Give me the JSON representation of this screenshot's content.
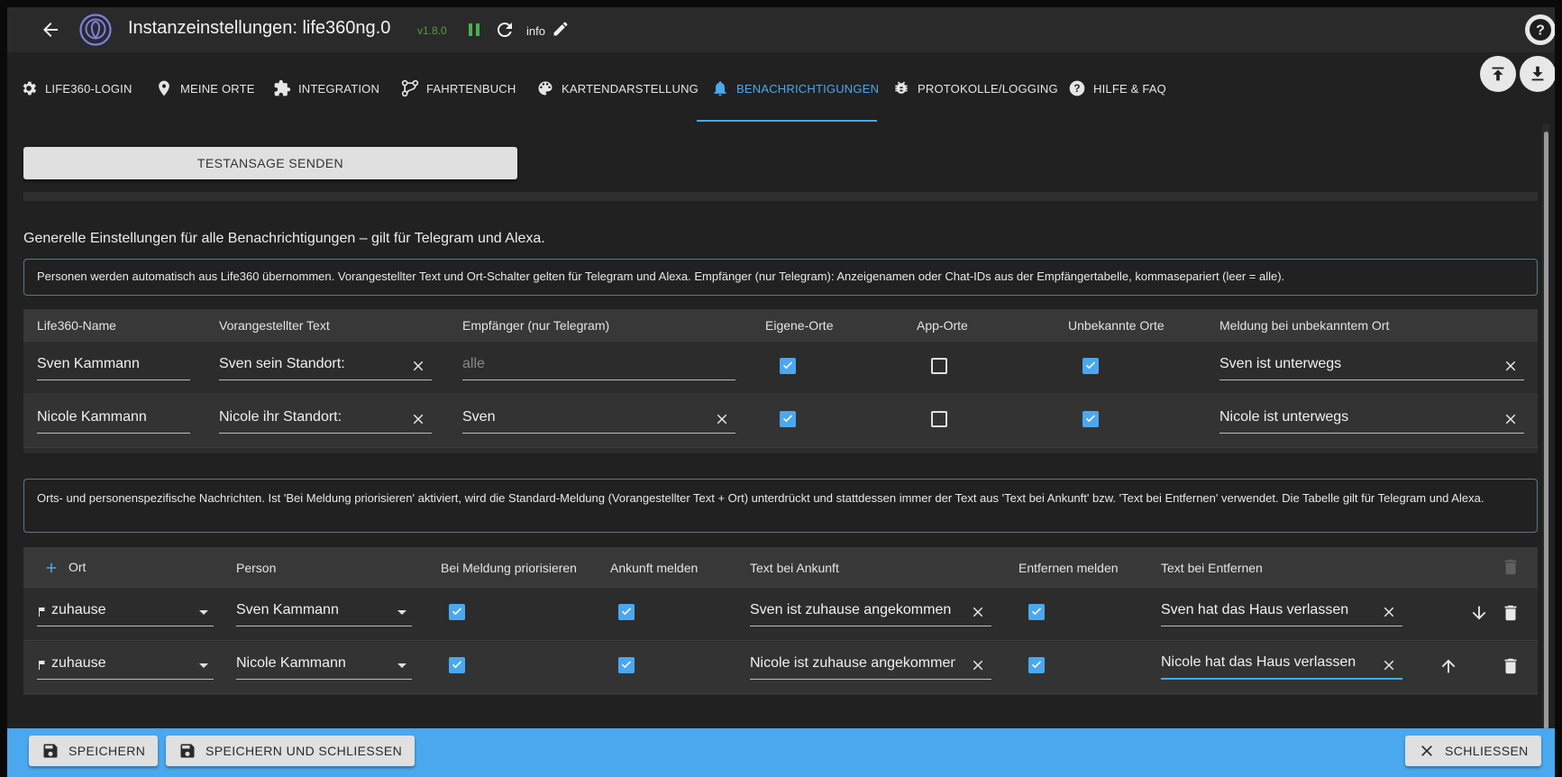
{
  "header": {
    "title": "Instanzeinstellungen:  life360ng.0",
    "version": "v1.8.0",
    "info_label": "info"
  },
  "tabs": [
    {
      "label": "LIFE360-LOGIN",
      "icon": "gear-icon"
    },
    {
      "label": "MEINE ORTE",
      "icon": "location-pin-icon"
    },
    {
      "label": "INTEGRATION",
      "icon": "puzzle-icon"
    },
    {
      "label": "FAHRTENBUCH",
      "icon": "route-icon"
    },
    {
      "label": "KARTENDARSTELLUNG",
      "icon": "palette-icon"
    },
    {
      "label": "BENACHRICHTIGUNGEN",
      "icon": "bell-icon",
      "active": true
    },
    {
      "label": "PROTOKOLLE/LOGGING",
      "icon": "bug-icon"
    },
    {
      "label": "HILFE & FAQ",
      "icon": "help-icon"
    }
  ],
  "test_button": "TESTANSAGE SENDEN",
  "general_heading": "Generelle Einstellungen für alle Benachrichtigungen – gilt für Telegram und Alexa.",
  "info1": "Personen werden automatisch aus Life360 übernommen. Vorangestellter Text und Ort-Schalter gelten für Telegram und Alexa. Empfänger (nur Telegram): Anzeigenamen oder Chat-IDs aus der Empfängertabelle, kommasepariert (leer = alle).",
  "persons_table": {
    "headers": [
      "Life360-Name",
      "Vorangestellter Text",
      "Empfänger (nur Telegram)",
      "Eigene-Orte",
      "App-Orte",
      "Unbekannte Orte",
      "Meldung bei unbekanntem Ort"
    ],
    "rows": [
      {
        "name": "Sven Kammann",
        "prefix": "Sven sein Standort:",
        "recipient": "",
        "recipient_placeholder": "alle",
        "own_places": true,
        "app_places": false,
        "unknown_places": true,
        "unknown_message": "Sven ist unterwegs"
      },
      {
        "name": "Nicole Kammann",
        "prefix": "Nicole ihr Standort:",
        "recipient": "Sven",
        "recipient_placeholder": "",
        "own_places": true,
        "app_places": false,
        "unknown_places": true,
        "unknown_message": "Nicole ist unterwegs"
      }
    ]
  },
  "info2": "Orts- und personenspezifische Nachrichten. Ist 'Bei Meldung priorisieren' aktiviert, wird die Standard-Meldung (Vorangestellter Text + Ort) unterdrückt und stattdessen immer der Text aus 'Text bei Ankunft' bzw. 'Text bei Entfernen' verwendet. Die Tabelle gilt für Telegram und Alexa.",
  "places_table": {
    "headers": [
      "Ort",
      "Person",
      "Bei Meldung priorisieren",
      "Ankunft melden",
      "Text bei Ankunft",
      "Entfernen melden",
      "Text bei Entfernen"
    ],
    "rows": [
      {
        "place": "zuhause",
        "person": "Sven Kammann",
        "prioritize": true,
        "arrival": true,
        "arrival_text": "Sven ist zuhause angekommen",
        "leave": true,
        "leave_text": "Sven hat das Haus verlassen"
      },
      {
        "place": "zuhause",
        "person": "Nicole Kammann",
        "prioritize": true,
        "arrival": true,
        "arrival_text": "Nicole ist zuhause angekommen",
        "leave": true,
        "leave_text": "Nicole hat das Haus verlassen"
      }
    ]
  },
  "footer": {
    "save": "SPEICHERN",
    "save_close": "SPEICHERN UND SCHLIESSEN",
    "close": "SCHLIESSEN"
  },
  "colors": {
    "accent": "#4aa8ee",
    "background": "#212121",
    "version": "#5a9a3e"
  }
}
